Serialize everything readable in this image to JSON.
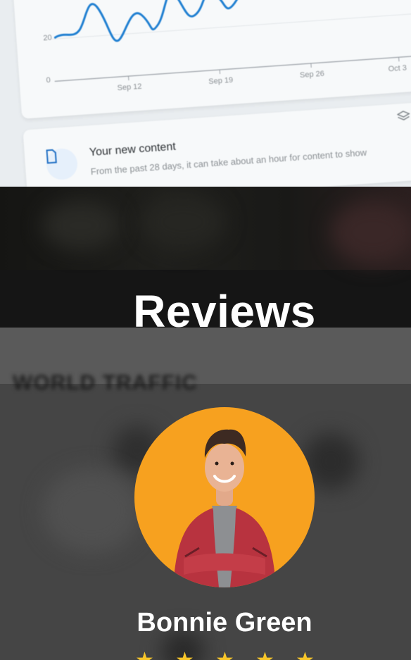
{
  "hero": {
    "chart": {
      "y_ticks": [
        "20",
        "0"
      ],
      "x_ticks": [
        "Sep 12",
        "Sep 19",
        "Sep 26",
        "Oct 3"
      ]
    },
    "content_card": {
      "title": "Your new content",
      "subtitle": "From the past 28 days, it can take about an hour for content to show"
    },
    "background_label": "WORLD TRAFFIC"
  },
  "reviews": {
    "heading": "Reviews",
    "reviewer": {
      "name": "Bonnie Green",
      "rating": 5
    }
  },
  "colors": {
    "accent": "#f7a11f",
    "star": "#f7c52a",
    "line": "#1f7fd1"
  }
}
